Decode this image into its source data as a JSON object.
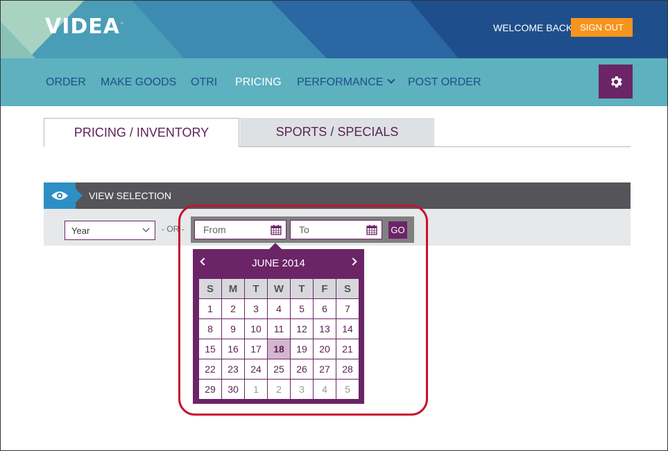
{
  "header": {
    "logo_text": "VIDEA",
    "logo_tm": "™",
    "welcome_text": "WELCOME BACK",
    "signout_label": "SIGN OUT"
  },
  "nav": {
    "items": [
      "ORDER",
      "MAKE GOODS",
      "OTRI",
      "PRICING",
      "PERFORMANCE",
      "POST ORDER"
    ],
    "active": "PRICING"
  },
  "tabs": [
    "PRICING / INVENTORY",
    "SPORTS / SPECIALS"
  ],
  "view_selection": {
    "title": "VIEW SELECTION",
    "year_placeholder": "Year",
    "or_text": "- OR -",
    "from_placeholder": "From",
    "to_placeholder": "To",
    "go_label": "GO"
  },
  "calendar": {
    "month_title": "JUNE 2014",
    "weekdays": [
      "S",
      "M",
      "T",
      "W",
      "T",
      "F",
      "S"
    ],
    "weeks": [
      [
        "1",
        "2",
        "3",
        "4",
        "5",
        "6",
        "7"
      ],
      [
        "8",
        "9",
        "10",
        "11",
        "12",
        "13",
        "14"
      ],
      [
        "15",
        "16",
        "17",
        "18",
        "19",
        "20",
        "21"
      ],
      [
        "22",
        "23",
        "24",
        "25",
        "26",
        "27",
        "28"
      ],
      [
        "29",
        "30",
        "1",
        "2",
        "3",
        "4",
        "5"
      ]
    ],
    "today": "18"
  },
  "colors": {
    "brand_purple": "#6b2567",
    "nav_teal": "#5eb1bf",
    "header_blue": "#1e4f8c",
    "signout_orange": "#f7941d",
    "highlight_red": "#c8102e"
  }
}
